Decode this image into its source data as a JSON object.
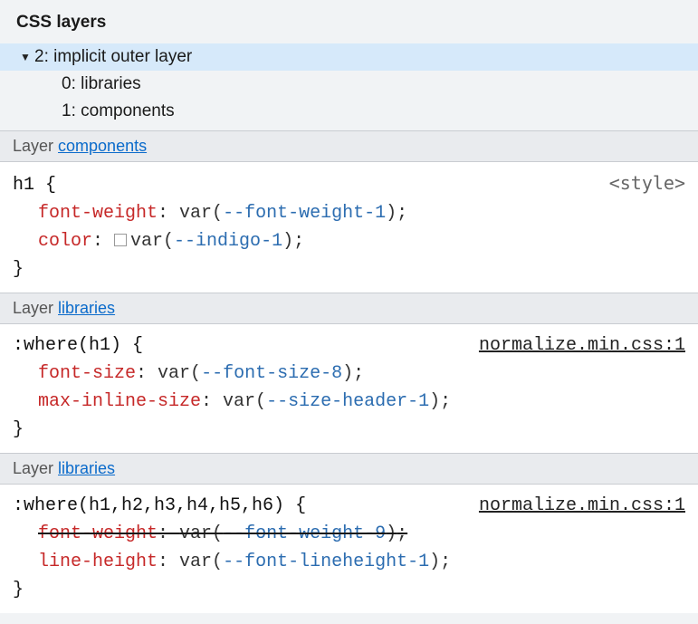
{
  "panel": {
    "title": "CSS layers"
  },
  "tree": {
    "root": {
      "label": "2: implicit outer layer"
    },
    "children": [
      {
        "label": "0: libraries"
      },
      {
        "label": "1: components"
      }
    ]
  },
  "colors": {
    "link": "#0b6bcb",
    "property": "#c62828",
    "varname": "#2b6cb0"
  },
  "blocks": [
    {
      "layer_prefix": "Layer ",
      "layer_name": "components",
      "selector": "h1",
      "source": "<style>",
      "source_is_link": false,
      "declarations": [
        {
          "prop": "font-weight",
          "var": "--font-weight-1",
          "overridden": false,
          "swatch": false
        },
        {
          "prop": "color",
          "var": "--indigo-1",
          "overridden": false,
          "swatch": true
        }
      ]
    },
    {
      "layer_prefix": "Layer ",
      "layer_name": "libraries",
      "selector": ":where(h1)",
      "source": "normalize.min.css:1",
      "source_is_link": true,
      "declarations": [
        {
          "prop": "font-size",
          "var": "--font-size-8",
          "overridden": false,
          "swatch": false
        },
        {
          "prop": "max-inline-size",
          "var": "--size-header-1",
          "overridden": false,
          "swatch": false
        }
      ]
    },
    {
      "layer_prefix": "Layer ",
      "layer_name": "libraries",
      "selector": ":where(h1,h2,h3,h4,h5,h6)",
      "source": "normalize.min.css:1",
      "source_is_link": true,
      "declarations": [
        {
          "prop": "font-weight",
          "var": "--font-weight-9",
          "overridden": true,
          "swatch": false
        },
        {
          "prop": "line-height",
          "var": "--font-lineheight-1",
          "overridden": false,
          "swatch": false
        }
      ]
    }
  ]
}
